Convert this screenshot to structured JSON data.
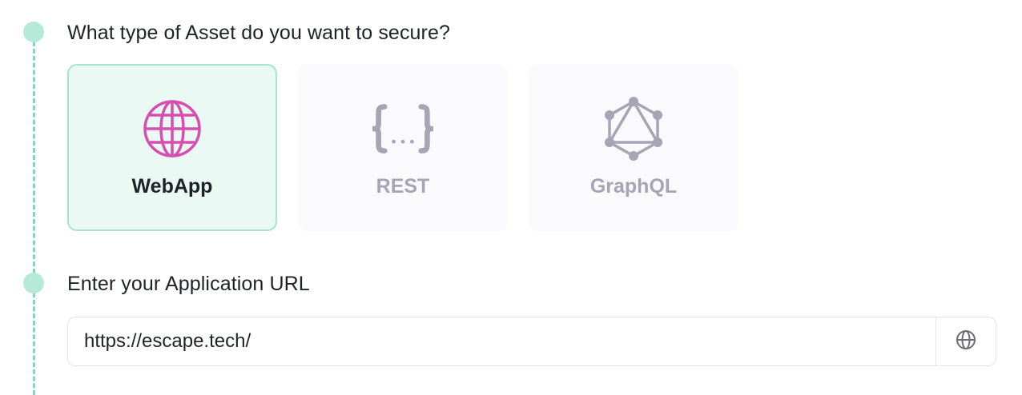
{
  "steps": [
    {
      "question": "What type of Asset do you want to secure?",
      "options": [
        {
          "label": "WebApp",
          "icon": "globe-icon",
          "selected": true
        },
        {
          "label": "REST",
          "icon": "curly-braces-icon",
          "selected": false
        },
        {
          "label": "GraphQL",
          "icon": "graphql-icon",
          "selected": false
        }
      ]
    },
    {
      "question": "Enter your Application URL",
      "url_value": "https://escape.tech/",
      "addon_icon": "globe-icon"
    }
  ],
  "colors": {
    "accent": "#7ed9bf",
    "step_dot": "#b5ead8",
    "selected_bg": "#ebf9f4",
    "selected_border": "#a8e4cd",
    "webapp_icon": "#d64fb0",
    "inactive": "#a6a4b5",
    "text": "#1f2328"
  }
}
